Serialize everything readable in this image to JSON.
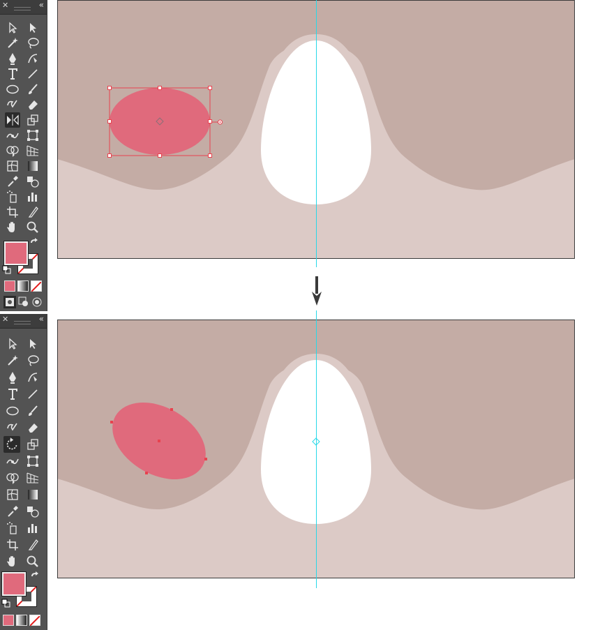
{
  "colors": {
    "toolbar_bg": "#535353",
    "artboard_bg": "#c4aca5",
    "ground": "#dccac6",
    "egg_halo": "#dccac6",
    "egg": "#ffffff",
    "ellipse_fill": "#e06a7c",
    "selection": "#e8424e",
    "guide": "#27d8e8",
    "arrow": "#3a3a3a"
  },
  "toolbar": {
    "close_glyph": "✕",
    "collapse_glyph": "«",
    "fill_color": "#e06a7c"
  },
  "panels": [
    {
      "id": "before",
      "active_tool": "reflect-tool",
      "ellipse_state": "selected"
    },
    {
      "id": "after",
      "active_tool": "rotate-tool",
      "ellipse_state": "rotated"
    }
  ],
  "arrow_icon": "arrow-down-icon"
}
